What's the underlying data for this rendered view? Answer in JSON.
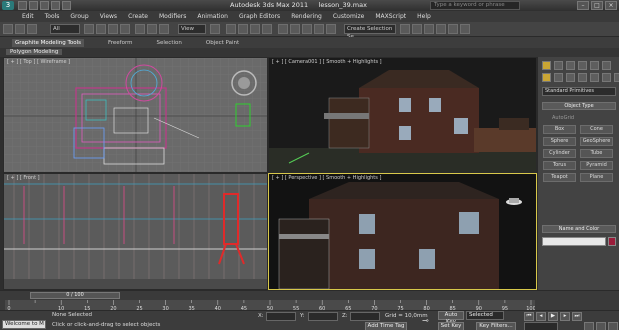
{
  "app": {
    "title": "Autodesk 3ds Max  2011",
    "file": "lesson_39.max",
    "search_placeholder": "Type a keyword or phrase"
  },
  "menu": [
    "Edit",
    "Tools",
    "Group",
    "Views",
    "Create",
    "Modifiers",
    "Animation",
    "Graph Editors",
    "Rendering",
    "Customize",
    "MAXScript",
    "Help"
  ],
  "toolbar": {
    "filter": "All",
    "coord": "View",
    "selection_set": "Create Selection Se"
  },
  "ribbon": {
    "tabs": [
      "Graphite Modeling Tools",
      "Freeform",
      "Selection",
      "Object Paint"
    ],
    "sub_tab": "Polygon Modeling"
  },
  "viewports": {
    "top": "[ + ] [ Top ] [ Wireframe ]",
    "camera": "[ + ] [ Camera001 ] [ Smooth + Highlights ]",
    "front": "[ + ] [ Front ]",
    "perspective": "[ + ] [ Perspective ] [ Smooth + Highlights ]"
  },
  "command_panel": {
    "category": "Standard Primitives",
    "object_type_header": "Object Type",
    "autogrid": "AutoGrid",
    "objects": [
      "Box",
      "Cone",
      "Sphere",
      "GeoSphere",
      "Cylinder",
      "Tube",
      "Torus",
      "Pyramid",
      "Teapot",
      "Plane"
    ],
    "name_color_header": "Name and Color",
    "color": "#9a1c3a"
  },
  "timeline": {
    "frame": "0 / 100",
    "ticks": [
      "0",
      "10",
      "15",
      "20",
      "25",
      "30",
      "35",
      "40",
      "45",
      "50",
      "55",
      "60",
      "65",
      "70",
      "75",
      "80",
      "85",
      "90",
      "95",
      "100"
    ]
  },
  "status": {
    "welcome": "Welcome to M",
    "selection": "None Selected",
    "prompt": "Click or click-and-drag to select objects",
    "x_label": "X:",
    "y_label": "Y:",
    "z_label": "Z:",
    "grid": "Grid = 10,0mm",
    "add_time_tag": "Add Time Tag",
    "auto_key": "Auto Key",
    "key_mode": "Selected",
    "set_key": "Set Key",
    "key_filters": "Key Filters..."
  }
}
